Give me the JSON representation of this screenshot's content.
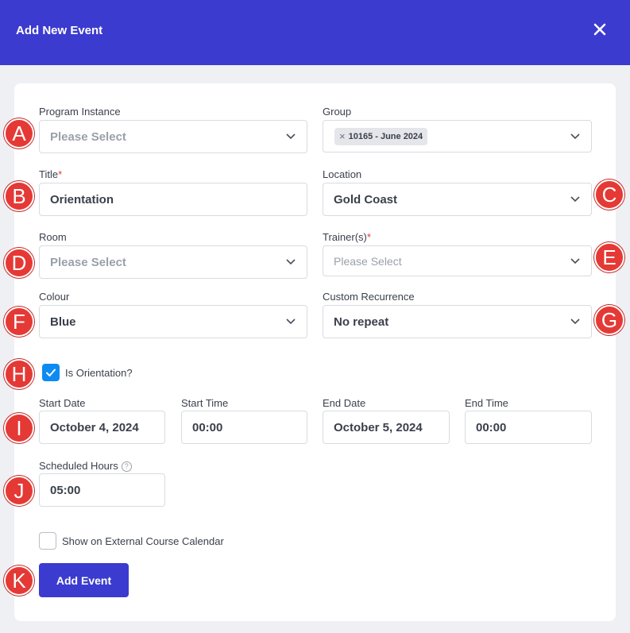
{
  "dialog": {
    "title": "Add New Event",
    "close_icon": "close-icon",
    "accent_color": "#3b3bd0"
  },
  "form": {
    "program_instance": {
      "label": "Program Instance",
      "placeholder": "Please Select"
    },
    "group": {
      "label": "Group",
      "tag": "10165 - June 2024",
      "tag_remove": "×"
    },
    "title": {
      "label": "Title",
      "required": "*",
      "value": "Orientation"
    },
    "location": {
      "label": "Location",
      "value": "Gold Coast"
    },
    "room": {
      "label": "Room",
      "placeholder": "Please Select"
    },
    "trainers": {
      "label": "Trainer(s)",
      "required": "*",
      "placeholder": "Please Select"
    },
    "colour": {
      "label": "Colour",
      "value": "Blue"
    },
    "custom_recurrence": {
      "label": "Custom Recurrence",
      "value": "No repeat"
    },
    "is_orientation": {
      "label": "Is Orientation?",
      "checked": true
    },
    "start_date": {
      "label": "Start Date",
      "value": "October 4, 2024"
    },
    "start_time": {
      "label": "Start Time",
      "value": "00:00"
    },
    "end_date": {
      "label": "End Date",
      "value": "October 5, 2024"
    },
    "end_time": {
      "label": "End Time",
      "value": "00:00"
    },
    "scheduled_hours": {
      "label": "Scheduled Hours",
      "help": "?",
      "value": "05:00"
    },
    "show_external": {
      "label": "Show on External Course Calendar",
      "checked": false
    },
    "submit_label": "Add Event"
  },
  "markers": [
    "A",
    "B",
    "C",
    "D",
    "E",
    "F",
    "G",
    "H",
    "I",
    "J",
    "K"
  ],
  "colors": {
    "marker": "#e53935",
    "checkbox_checked": "#0d8bf2",
    "required": "#e53935"
  }
}
